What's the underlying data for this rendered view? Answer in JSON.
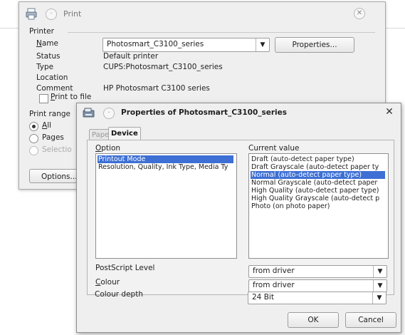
{
  "print_dialog": {
    "title": "Print",
    "printer_group_title": "Printer",
    "name_label": "Name",
    "printer_name": "Photosmart_C3100_series",
    "properties_button": "Properties...",
    "status_label": "Status",
    "status_value": "Default printer",
    "type_label": "Type",
    "type_value": "CUPS:Photosmart_C3100_series",
    "location_label": "Location",
    "location_value": "",
    "comment_label": "Comment",
    "comment_value": "HP Photosmart C3100 series",
    "print_to_file_label": "Print to file",
    "print_to_file_checked": false,
    "print_range_title": "Print range",
    "range_all": "All",
    "range_pages": "Pages",
    "range_selection": "Selectio",
    "options_button": "Options..."
  },
  "properties_dialog": {
    "title": "Properties of Photosmart_C3100_series",
    "tabs": [
      {
        "label": "Paper",
        "active": false
      },
      {
        "label": "Device",
        "active": true
      }
    ],
    "option_header": "Option",
    "options": [
      {
        "label": "Printout Mode",
        "selected": true
      },
      {
        "label": "Resolution, Quality, Ink Type, Media Ty",
        "selected": false
      }
    ],
    "current_value_header": "Current value",
    "values": [
      {
        "label": "Draft (auto-detect paper type)",
        "selected": false
      },
      {
        "label": "Draft Grayscale (auto-detect paper ty",
        "selected": false
      },
      {
        "label": "Normal (auto-detect paper type)",
        "selected": true
      },
      {
        "label": "Normal Grayscale (auto-detect paper",
        "selected": false
      },
      {
        "label": "High Quality (auto-detect paper type)",
        "selected": false
      },
      {
        "label": "High Quality Grayscale (auto-detect p",
        "selected": false
      },
      {
        "label": "Photo (on photo paper)",
        "selected": false
      }
    ],
    "postscript_level_label": "PostScript Level",
    "postscript_level_value": "from driver",
    "colour_label": "Colour",
    "colour_value": "from driver",
    "colour_depth_label": "Colour depth",
    "colour_depth_value": "24 Bit",
    "ok_button": "OK",
    "cancel_button": "Cancel"
  },
  "colors": {
    "selection": "#3d6fd4",
    "dialog_bg": "#efefef",
    "page_bg": "#ffffff"
  },
  "icons": [
    "printer-app-icon",
    "help-icon",
    "close-icon",
    "dropdown-arrow-icon"
  ]
}
